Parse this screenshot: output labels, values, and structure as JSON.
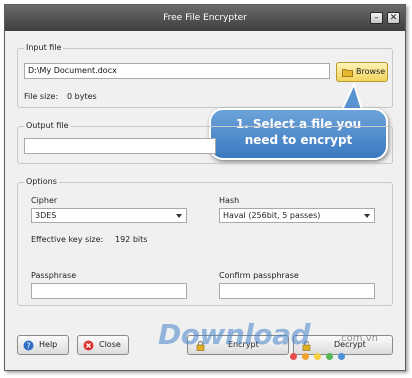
{
  "window": {
    "title": "Free File Encrypter"
  },
  "input_group": {
    "title": "Input file",
    "path": "D:\\My Document.docx",
    "browse_label": "Browse",
    "size_label": "File size:",
    "size_value": "0 bytes"
  },
  "callout": {
    "line1": "1. Select a file you",
    "line2": "need to encrypt"
  },
  "output_group": {
    "title": "Output file",
    "path": ""
  },
  "options": {
    "title": "Options",
    "cipher_label": "Cipher",
    "cipher_value": "3DES",
    "hash_label": "Hash",
    "hash_value": "Haval (256bit, 5 passes)",
    "keysize_label": "Effective key size:",
    "keysize_value": "192 bits",
    "passphrase_label": "Passphrase",
    "confirm_label": "Confirm passphrase"
  },
  "buttons": {
    "help": "Help",
    "close": "Close",
    "encrypt": "Encrypt",
    "decrypt": "Decrypt"
  },
  "watermark": {
    "text": "Download",
    "suffix": ".com.vn"
  },
  "colors": {
    "accent": "#3a79c0",
    "titlebar": "#4f4f4f"
  }
}
